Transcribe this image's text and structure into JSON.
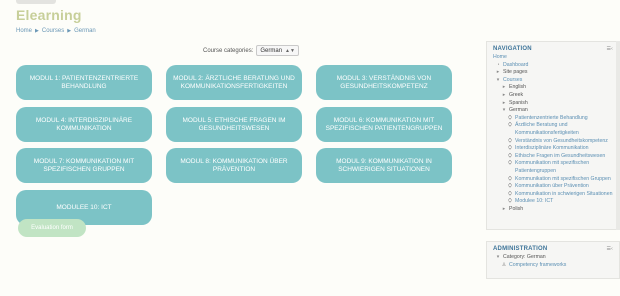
{
  "site": {
    "title": "Elearning"
  },
  "breadcrumb": [
    "Home",
    "Courses",
    "German"
  ],
  "category_select": {
    "label": "Course categories:",
    "value": "German"
  },
  "modules": [
    "Modul 1: Patientenzentrierte Behandlung",
    "Modul 2: Ärztliche Beratung und Kommunikationsfertigkeiten",
    "Modul 3: Verständnis von Gesundheitskompetenz",
    "Modul 4: Interdisziplinäre Kommunikation",
    "Modul 5: Ethische Fragen im Gesundheitswesen",
    "Modul 6: Kommunikation mit spezifischen Patientengruppen",
    "Modul 7: Kommunikation mit spezifischen Gruppen",
    "Modul 8: Kommunikation über Prävention",
    "Modul 9: Kommunikation in schwierigen Situationen",
    "Modulee 10: ICT"
  ],
  "evaluation_button": "Evaluation form",
  "navigation": {
    "title": "NAVIGATION",
    "home": "Home",
    "dashboard": "Dashboard",
    "site_pages": "Site pages",
    "courses": "Courses",
    "languages": [
      "English",
      "Greek",
      "Spanish",
      "German"
    ],
    "german_items": [
      "Patientenzentrierte Behandlung",
      "Ärztliche Beratung und Kommunikationsfertigkeiten",
      "Verständnis von Gesundheitskompetenz",
      "Interdisziplinäre Kommunikation",
      "Ethische Fragen im Gesundheitswesen",
      "Kommunikation mit spezifischen Patientengruppen",
      "Kommunikation mit spezifischen Gruppen",
      "Kommunikation über Prävention",
      "Kommunikation in schwierigen Situationen",
      "Modulee 10: ICT"
    ],
    "polish": "Polish"
  },
  "administration": {
    "title": "ADMINISTRATION",
    "category": "Category: German",
    "competency": "Competency frameworks"
  }
}
